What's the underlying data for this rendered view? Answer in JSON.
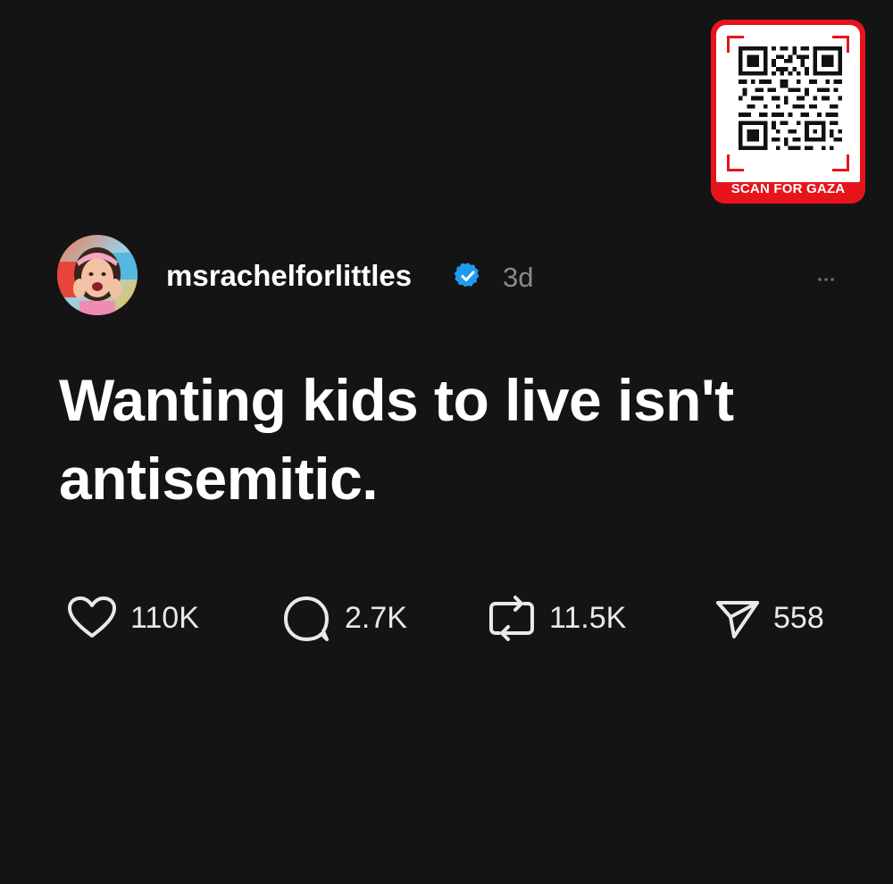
{
  "badge": {
    "caption": "SCAN FOR GAZA",
    "accent_color": "#e8141c",
    "icon": "qr-code-icon"
  },
  "post": {
    "username": "msrachelforlittles",
    "verified": true,
    "time": "3d",
    "text": "Wanting kids to live isn't antisemitic.",
    "more_icon": "ellipsis-icon",
    "avatar": "user-avatar"
  },
  "actions": {
    "likes": {
      "icon": "heart-icon",
      "count": "110K"
    },
    "comments": {
      "icon": "comment-icon",
      "count": "2.7K"
    },
    "reposts": {
      "icon": "repost-icon",
      "count": "11.5K"
    },
    "shares": {
      "icon": "send-icon",
      "count": "558"
    }
  },
  "colors": {
    "background": "#141414",
    "verified": "#1d9bf0",
    "muted_text": "#8a8a8a"
  }
}
